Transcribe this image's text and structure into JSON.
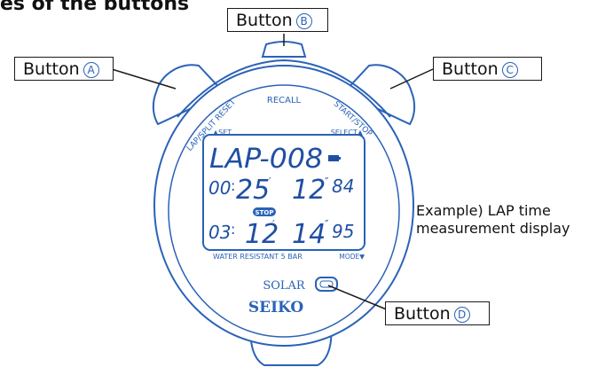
{
  "heading": "es of the buttons",
  "callouts": {
    "a": {
      "label": "Button",
      "marker": "A"
    },
    "b": {
      "label": "Button",
      "marker": "B"
    },
    "c": {
      "label": "Button",
      "marker": "C"
    },
    "d": {
      "label": "Button",
      "marker": "D"
    }
  },
  "example": {
    "line1": "Example) LAP time",
    "line2": "measurement display"
  },
  "bezel": {
    "recall": "RECALL",
    "lap_split_reset": "LAP/SPLIT RESET",
    "start_stop": "START/STOP",
    "set": "▲SET",
    "select": "SELECT▲",
    "water": "WATER RESISTANT 5 BAR",
    "mode": "MODE▼",
    "solar": "SOLAR",
    "brand": "SEIKO"
  },
  "lcd": {
    "row1": "LAP-008",
    "row2": {
      "h": "00",
      "m": "25",
      "s": "12",
      "cs": "84"
    },
    "stop_badge": "STOP",
    "row3": {
      "h": "03",
      "m": "12",
      "s": "14",
      "cs": "95"
    }
  },
  "colors": {
    "outline": "#2a62b8",
    "lcd_text": "#1f4fa3",
    "badge": "#2a62b8",
    "ink": "#111111"
  }
}
